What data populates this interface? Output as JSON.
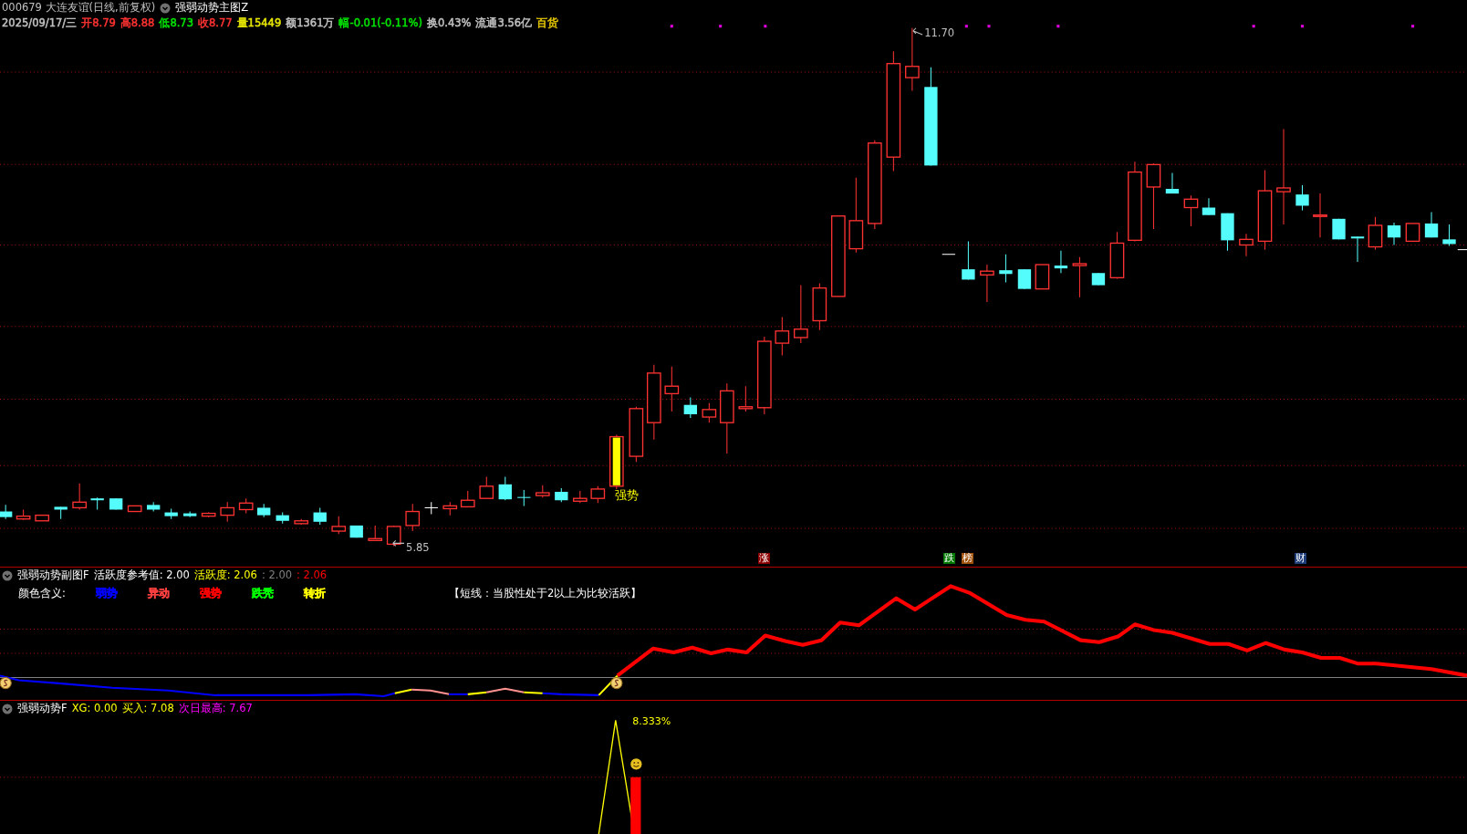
{
  "header": {
    "stock_title": "000679 大连友谊(日线,前复权)",
    "indicator_name": "强弱动势主图Z",
    "quote": [
      {
        "text": "2025/09/17/三",
        "color": "#c0c0c0"
      },
      {
        "text": "开8.79",
        "color": "#ff3232"
      },
      {
        "text": "高8.88",
        "color": "#ff3232"
      },
      {
        "text": "低8.73",
        "color": "#00e600"
      },
      {
        "text": "收8.77",
        "color": "#ff3232"
      },
      {
        "text": "量15449",
        "color": "#e6e600"
      },
      {
        "text": "额1361万",
        "color": "#c0c0c0"
      },
      {
        "text": "幅-0.01(-0.11%)",
        "color": "#00e600"
      },
      {
        "text": "换0.43%",
        "color": "#c0c0c0"
      },
      {
        "text": "流通3.56亿",
        "color": "#c0c0c0"
      },
      {
        "text": "百货",
        "color": "#e6c800"
      }
    ]
  },
  "main_chart": {
    "high_label": "11.70",
    "low_label": "5.85",
    "signal_label": "强势",
    "markers": [
      {
        "text": "涨",
        "color": "#8b0000"
      },
      {
        "text": "跌",
        "color": "#007800"
      },
      {
        "text": "榜",
        "color": "#a0500a"
      },
      {
        "text": "财",
        "color": "#1e3c78"
      }
    ]
  },
  "sub_panel": {
    "name": "强弱动势副图F",
    "params": [
      {
        "text": "活跃度参考值: 2.00",
        "color": "#ffffff"
      },
      {
        "text": "活跃度: 2.06",
        "color": "#ffff00"
      },
      {
        "text": ": 2.00",
        "color": "#808080"
      },
      {
        "text": ": 2.06",
        "color": "#ff0000"
      }
    ],
    "legend_label": "颜色含义:",
    "legend": [
      {
        "text": "弱势",
        "color": "#0000ff"
      },
      {
        "text": "异动",
        "color": "#ff4040"
      },
      {
        "text": "强势",
        "color": "#ff0000"
      },
      {
        "text": "跌秃",
        "color": "#00ff00"
      },
      {
        "text": "转折",
        "color": "#ffff00"
      }
    ],
    "note": "【短线：当股性处于2以上为比较活跃】"
  },
  "bottom_panel": {
    "name": "强弱动势F",
    "params": [
      {
        "text": "XG: 0.00",
        "color": "#ffff00"
      },
      {
        "text": "买入: 7.08",
        "color": "#ffff00"
      },
      {
        "text": "次日最高: 7.67",
        "color": "#ff00ff"
      }
    ],
    "percent_label": "8.333%"
  }
}
